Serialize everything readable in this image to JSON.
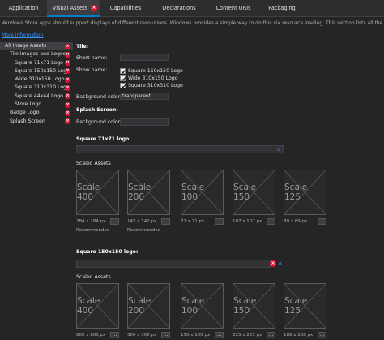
{
  "tabs": [
    {
      "label": "Application",
      "active": false
    },
    {
      "label": "Visual Assets",
      "active": true
    },
    {
      "label": "Capabilities",
      "active": false
    },
    {
      "label": "Declarations",
      "active": false
    },
    {
      "label": "Content URIs",
      "active": false
    },
    {
      "label": "Packaging",
      "active": false
    }
  ],
  "intro_text": "Windows Store apps should support displays of different resolutions. Windows provides a simple way to do this via resource loading. This section lists all the assets which are used as",
  "more_info": "More information",
  "tree": [
    {
      "label": "All Image Assets",
      "error": true
    },
    {
      "label": "Tile Images and Logos",
      "error": true
    },
    {
      "label": "Square 71x71 Logo",
      "error": true
    },
    {
      "label": "Square 150x150 Logo",
      "error": true
    },
    {
      "label": "Wide 310x150 Logo",
      "error": true
    },
    {
      "label": "Square 310x310 Logo",
      "error": true
    },
    {
      "label": "Square 44x44 Logo",
      "error": true
    },
    {
      "label": "Store Logo",
      "error": true
    },
    {
      "label": "Badge Logo",
      "error": true
    },
    {
      "label": "Splash Screen",
      "error": true
    }
  ],
  "tile": {
    "header": "Tile:",
    "short_name_label": "Short name:",
    "short_name_value": "",
    "show_name_label": "Show name:",
    "show_name_options": [
      "Square 150x150 Logo",
      "Wide 310x150 Logo",
      "Square 310x310 Logo"
    ],
    "bg_label": "Background color:",
    "bg_value": "transparent"
  },
  "splash": {
    "header": "Splash Screen:",
    "bg_label": "Background color:",
    "bg_value": ""
  },
  "square71": {
    "header": "Square 71x71 logo:",
    "path": "",
    "scaled_label": "Scaled Assets",
    "scales": [
      {
        "label": "Scale 400",
        "size": "284 x 284 px",
        "note": "Recommended"
      },
      {
        "label": "Scale 200",
        "size": "142 x 142 px",
        "note": "Recommended"
      },
      {
        "label": "Scale 100",
        "size": "71 x 71 px",
        "note": ""
      },
      {
        "label": "Scale 150",
        "size": "107 x 107 px",
        "note": ""
      },
      {
        "label": "Scale 125",
        "size": "89 x 89 px",
        "note": ""
      }
    ]
  },
  "square150": {
    "header": "Square 150x150 logo:",
    "path": "",
    "scaled_label": "Scaled Assets",
    "scales": [
      {
        "label": "Scale 400",
        "size": "600 x 600 px"
      },
      {
        "label": "Scale 200",
        "size": "300 x 300 px"
      },
      {
        "label": "Scale 100",
        "size": "150 x 150 px"
      },
      {
        "label": "Scale 150",
        "size": "225 x 225 px"
      },
      {
        "label": "Scale 125",
        "size": "188 x 188 px"
      }
    ]
  },
  "browse_label": "...",
  "colors": {
    "accent": "#007acc",
    "error": "#e8112d",
    "link": "#3794ff",
    "background": "#252526"
  }
}
